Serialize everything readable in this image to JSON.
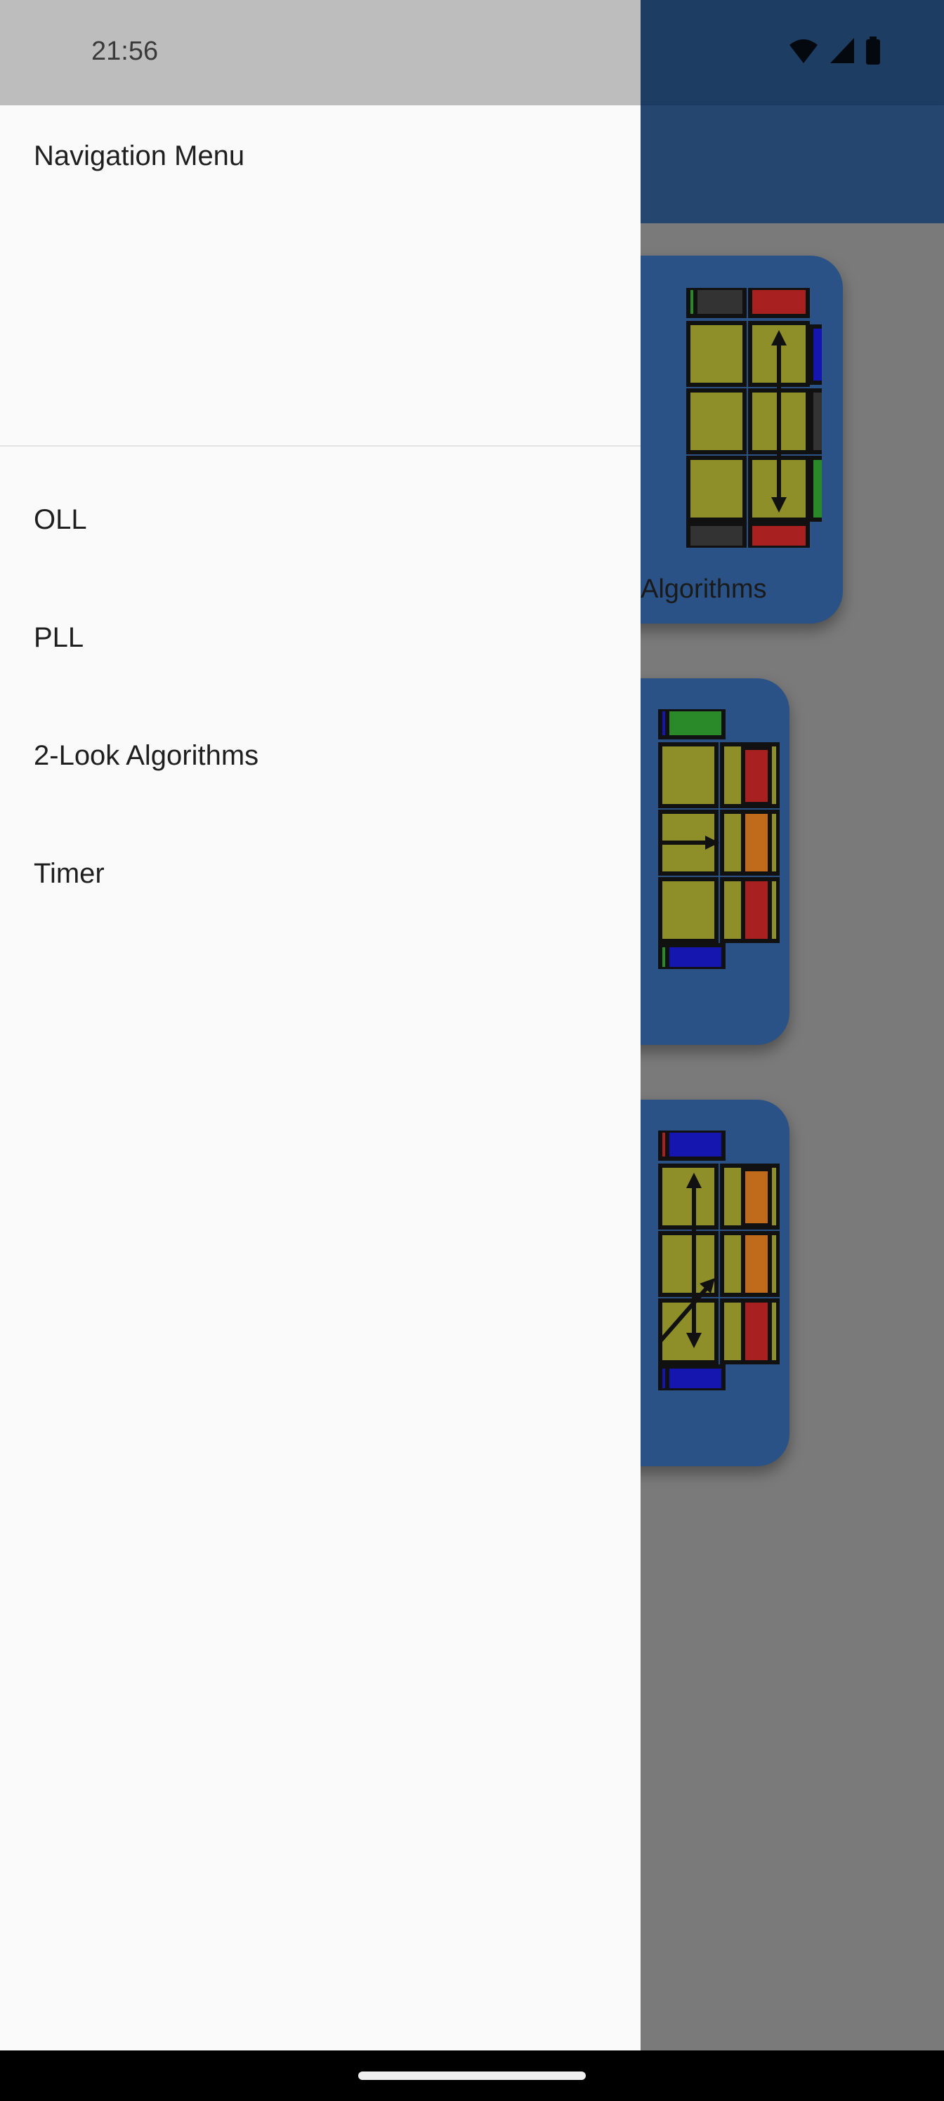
{
  "status_bar": {
    "time": "21:56"
  },
  "drawer": {
    "title": "Navigation Menu",
    "items": [
      {
        "label": "OLL"
      },
      {
        "label": "PLL"
      },
      {
        "label": "2-Look Algorithms"
      },
      {
        "label": "Timer"
      }
    ]
  },
  "background": {
    "cards": [
      {
        "label": "Algorithms",
        "image": "cube-last-layer-diagram"
      },
      {
        "label": "",
        "image": "cube-last-layer-diagram"
      },
      {
        "label": "",
        "image": "cube-last-layer-diagram"
      }
    ]
  },
  "colors": {
    "drawer_bg": "#fafafa",
    "status_bar_drawer": "#bdbdbd",
    "app_bar": "#24466f",
    "card_bg": "#2a5286",
    "scrim": "#7a7a7a"
  }
}
